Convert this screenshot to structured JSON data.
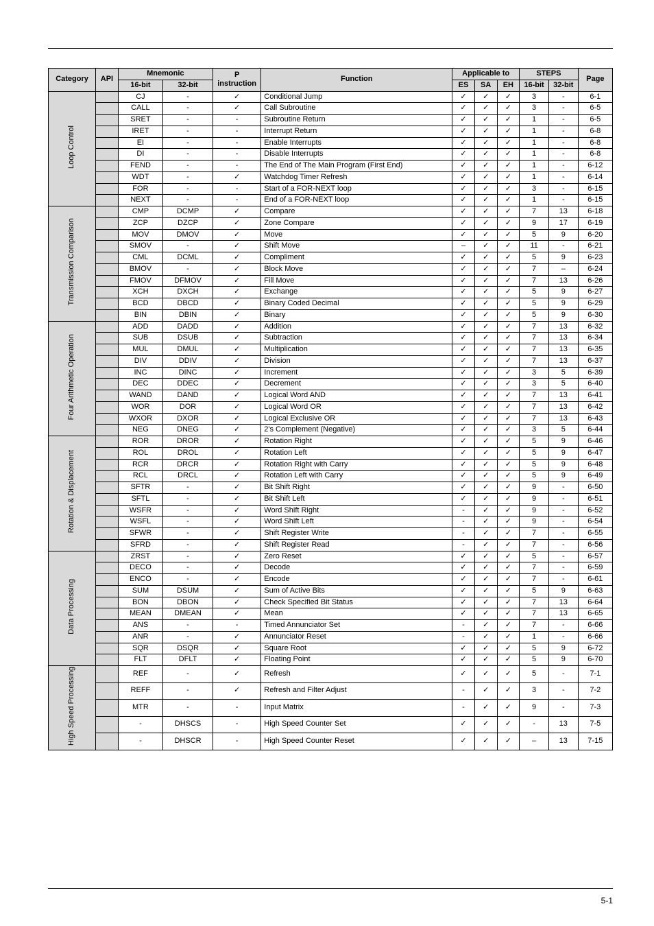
{
  "headers": {
    "category": "Category",
    "api": "API",
    "mnemonic": "Mnemonic",
    "p_instruction_top": "P",
    "p_instruction_bottom": "instruction",
    "function": "Function",
    "applicable": "Applicable to",
    "steps": "STEPS",
    "page": "Page",
    "m16": "16-bit",
    "m32": "32-bit",
    "es": "ES",
    "sa": "SA",
    "eh": "EH",
    "s16": "16-bit",
    "s32": "32-bit"
  },
  "footer": "5-1",
  "chart_data": {
    "type": "table",
    "title": "Instruction Reference Table",
    "columns": [
      "Category",
      "API",
      "Mnemonic 16-bit",
      "Mnemonic 32-bit",
      "P instruction",
      "Function",
      "ES",
      "SA",
      "EH",
      "STEPS 16-bit",
      "STEPS 32-bit",
      "Page"
    ],
    "groups": [
      {
        "category": "Loop Control",
        "rows": [
          {
            "api": "",
            "m16": "CJ",
            "m32": "-",
            "p": "✓",
            "fn": "Conditional Jump",
            "es": "✓",
            "sa": "✓",
            "eh": "✓",
            "s16": "3",
            "s32": "-",
            "page": "6-1"
          },
          {
            "api": "",
            "m16": "CALL",
            "m32": "-",
            "p": "✓",
            "fn": "Call Subroutine",
            "es": "✓",
            "sa": "✓",
            "eh": "✓",
            "s16": "3",
            "s32": "-",
            "page": "6-5"
          },
          {
            "api": "",
            "m16": "SRET",
            "m32": "-",
            "p": "-",
            "fn": "Subroutine Return",
            "es": "✓",
            "sa": "✓",
            "eh": "✓",
            "s16": "1",
            "s32": "-",
            "page": "6-5"
          },
          {
            "api": "",
            "m16": "IRET",
            "m32": "-",
            "p": "-",
            "fn": "Interrupt Return",
            "es": "✓",
            "sa": "✓",
            "eh": "✓",
            "s16": "1",
            "s32": "-",
            "page": "6-8"
          },
          {
            "api": "",
            "m16": "EI",
            "m32": "-",
            "p": "-",
            "fn": "Enable Interrupts",
            "es": "✓",
            "sa": "✓",
            "eh": "✓",
            "s16": "1",
            "s32": "-",
            "page": "6-8"
          },
          {
            "api": "",
            "m16": "DI",
            "m32": "-",
            "p": "-",
            "fn": "Disable Interrupts",
            "es": "✓",
            "sa": "✓",
            "eh": "✓",
            "s16": "1",
            "s32": "-",
            "page": "6-8"
          },
          {
            "api": "",
            "m16": "FEND",
            "m32": "-",
            "p": "-",
            "fn": "The End of The Main Program (First End)",
            "es": "✓",
            "sa": "✓",
            "eh": "✓",
            "s16": "1",
            "s32": "-",
            "page": "6-12"
          },
          {
            "api": "",
            "m16": "WDT",
            "m32": "-",
            "p": "✓",
            "fn": "Watchdog Timer Refresh",
            "es": "✓",
            "sa": "✓",
            "eh": "✓",
            "s16": "1",
            "s32": "-",
            "page": "6-14"
          },
          {
            "api": "",
            "m16": "FOR",
            "m32": "-",
            "p": "-",
            "fn": "Start of a FOR-NEXT loop",
            "es": "✓",
            "sa": "✓",
            "eh": "✓",
            "s16": "3",
            "s32": "-",
            "page": "6-15"
          },
          {
            "api": "",
            "m16": "NEXT",
            "m32": "-",
            "p": "-",
            "fn": "End of a FOR-NEXT loop",
            "es": "✓",
            "sa": "✓",
            "eh": "✓",
            "s16": "1",
            "s32": "-",
            "page": "6-15"
          }
        ]
      },
      {
        "category": "Transmission Comparison",
        "rows": [
          {
            "api": "",
            "m16": "CMP",
            "m32": "DCMP",
            "p": "✓",
            "fn": "Compare",
            "es": "✓",
            "sa": "✓",
            "eh": "✓",
            "s16": "7",
            "s32": "13",
            "page": "6-18"
          },
          {
            "api": "",
            "m16": "ZCP",
            "m32": "DZCP",
            "p": "✓",
            "fn": "Zone Compare",
            "es": "✓",
            "sa": "✓",
            "eh": "✓",
            "s16": "9",
            "s32": "17",
            "page": "6-19"
          },
          {
            "api": "",
            "m16": "MOV",
            "m32": "DMOV",
            "p": "✓",
            "fn": "Move",
            "es": "✓",
            "sa": "✓",
            "eh": "✓",
            "s16": "5",
            "s32": "9",
            "page": "6-20"
          },
          {
            "api": "",
            "m16": "SMOV",
            "m32": "-",
            "p": "✓",
            "fn": "Shift Move",
            "es": "–",
            "sa": "✓",
            "eh": "✓",
            "s16": "11",
            "s32": "-",
            "page": "6-21"
          },
          {
            "api": "",
            "m16": "CML",
            "m32": "DCML",
            "p": "✓",
            "fn": "Compliment",
            "es": "✓",
            "sa": "✓",
            "eh": "✓",
            "s16": "5",
            "s32": "9",
            "page": "6-23"
          },
          {
            "api": "",
            "m16": "BMOV",
            "m32": "-",
            "p": "✓",
            "fn": "Block Move",
            "es": "✓",
            "sa": "✓",
            "eh": "✓",
            "s16": "7",
            "s32": "–",
            "page": "6-24"
          },
          {
            "api": "",
            "m16": "FMOV",
            "m32": "DFMOV",
            "p": "✓",
            "fn": "Fill Move",
            "es": "✓",
            "sa": "✓",
            "eh": "✓",
            "s16": "7",
            "s32": "13",
            "page": "6-26"
          },
          {
            "api": "",
            "m16": "XCH",
            "m32": "DXCH",
            "p": "✓",
            "fn": "Exchange",
            "es": "✓",
            "sa": "✓",
            "eh": "✓",
            "s16": "5",
            "s32": "9",
            "page": "6-27"
          },
          {
            "api": "",
            "m16": "BCD",
            "m32": "DBCD",
            "p": "✓",
            "fn": "Binary Coded Decimal",
            "es": "✓",
            "sa": "✓",
            "eh": "✓",
            "s16": "5",
            "s32": "9",
            "page": "6-29"
          },
          {
            "api": "",
            "m16": "BIN",
            "m32": "DBIN",
            "p": "✓",
            "fn": "Binary",
            "es": "✓",
            "sa": "✓",
            "eh": "✓",
            "s16": "5",
            "s32": "9",
            "page": "6-30"
          }
        ]
      },
      {
        "category": "Four Arithmetic Operation",
        "rows": [
          {
            "api": "",
            "m16": "ADD",
            "m32": "DADD",
            "p": "✓",
            "fn": "Addition",
            "es": "✓",
            "sa": "✓",
            "eh": "✓",
            "s16": "7",
            "s32": "13",
            "page": "6-32"
          },
          {
            "api": "",
            "m16": "SUB",
            "m32": "DSUB",
            "p": "✓",
            "fn": "Subtraction",
            "es": "✓",
            "sa": "✓",
            "eh": "✓",
            "s16": "7",
            "s32": "13",
            "page": "6-34"
          },
          {
            "api": "",
            "m16": "MUL",
            "m32": "DMUL",
            "p": "✓",
            "fn": "Multiplication",
            "es": "✓",
            "sa": "✓",
            "eh": "✓",
            "s16": "7",
            "s32": "13",
            "page": "6-35"
          },
          {
            "api": "",
            "m16": "DIV",
            "m32": "DDIV",
            "p": "✓",
            "fn": "Division",
            "es": "✓",
            "sa": "✓",
            "eh": "✓",
            "s16": "7",
            "s32": "13",
            "page": "6-37"
          },
          {
            "api": "",
            "m16": "INC",
            "m32": "DINC",
            "p": "✓",
            "fn": "Increment",
            "es": "✓",
            "sa": "✓",
            "eh": "✓",
            "s16": "3",
            "s32": "5",
            "page": "6-39"
          },
          {
            "api": "",
            "m16": "DEC",
            "m32": "DDEC",
            "p": "✓",
            "fn": "Decrement",
            "es": "✓",
            "sa": "✓",
            "eh": "✓",
            "s16": "3",
            "s32": "5",
            "page": "6-40"
          },
          {
            "api": "",
            "m16": "WAND",
            "m32": "DAND",
            "p": "✓",
            "fn": "Logical Word AND",
            "es": "✓",
            "sa": "✓",
            "eh": "✓",
            "s16": "7",
            "s32": "13",
            "page": "6-41"
          },
          {
            "api": "",
            "m16": "WOR",
            "m32": "DOR",
            "p": "✓",
            "fn": "Logical Word OR",
            "es": "✓",
            "sa": "✓",
            "eh": "✓",
            "s16": "7",
            "s32": "13",
            "page": "6-42"
          },
          {
            "api": "",
            "m16": "WXOR",
            "m32": "DXOR",
            "p": "✓",
            "fn": "Logical Exclusive OR",
            "es": "✓",
            "sa": "✓",
            "eh": "✓",
            "s16": "7",
            "s32": "13",
            "page": "6-43"
          },
          {
            "api": "",
            "m16": "NEG",
            "m32": "DNEG",
            "p": "✓",
            "fn": "2's Complement (Negative)",
            "es": "✓",
            "sa": "✓",
            "eh": "✓",
            "s16": "3",
            "s32": "5",
            "page": "6-44"
          }
        ]
      },
      {
        "category": "Rotation & Displacement",
        "rows": [
          {
            "api": "",
            "m16": "ROR",
            "m32": "DROR",
            "p": "✓",
            "fn": "Rotation Right",
            "es": "✓",
            "sa": "✓",
            "eh": "✓",
            "s16": "5",
            "s32": "9",
            "page": "6-46"
          },
          {
            "api": "",
            "m16": "ROL",
            "m32": "DROL",
            "p": "✓",
            "fn": "Rotation Left",
            "es": "✓",
            "sa": "✓",
            "eh": "✓",
            "s16": "5",
            "s32": "9",
            "page": "6-47"
          },
          {
            "api": "",
            "m16": "RCR",
            "m32": "DRCR",
            "p": "✓",
            "fn": "Rotation Right with Carry",
            "es": "✓",
            "sa": "✓",
            "eh": "✓",
            "s16": "5",
            "s32": "9",
            "page": "6-48"
          },
          {
            "api": "",
            "m16": "RCL",
            "m32": "DRCL",
            "p": "✓",
            "fn": "Rotation Left with Carry",
            "es": "✓",
            "sa": "✓",
            "eh": "✓",
            "s16": "5",
            "s32": "9",
            "page": "6-49"
          },
          {
            "api": "",
            "m16": "SFTR",
            "m32": "-",
            "p": "✓",
            "fn": "Bit Shift Right",
            "es": "✓",
            "sa": "✓",
            "eh": "✓",
            "s16": "9",
            "s32": "-",
            "page": "6-50"
          },
          {
            "api": "",
            "m16": "SFTL",
            "m32": "-",
            "p": "✓",
            "fn": "Bit Shift Left",
            "es": "✓",
            "sa": "✓",
            "eh": "✓",
            "s16": "9",
            "s32": "-",
            "page": "6-51"
          },
          {
            "api": "",
            "m16": "WSFR",
            "m32": "-",
            "p": "✓",
            "fn": "Word Shift Right",
            "es": "-",
            "sa": "✓",
            "eh": "✓",
            "s16": "9",
            "s32": "-",
            "page": "6-52"
          },
          {
            "api": "",
            "m16": "WSFL",
            "m32": "-",
            "p": "✓",
            "fn": "Word Shift Left",
            "es": "-",
            "sa": "✓",
            "eh": "✓",
            "s16": "9",
            "s32": "-",
            "page": "6-54"
          },
          {
            "api": "",
            "m16": "SFWR",
            "m32": "-",
            "p": "✓",
            "fn": "Shift Register Write",
            "es": "-",
            "sa": "✓",
            "eh": "✓",
            "s16": "7",
            "s32": "-",
            "page": "6-55"
          },
          {
            "api": "",
            "m16": "SFRD",
            "m32": "-",
            "p": "✓",
            "fn": "Shift Register Read",
            "es": "-",
            "sa": "✓",
            "eh": "✓",
            "s16": "7",
            "s32": "-",
            "page": "6-56"
          }
        ]
      },
      {
        "category": "Data Processing",
        "rows": [
          {
            "api": "",
            "m16": "ZRST",
            "m32": "-",
            "p": "✓",
            "fn": "Zero Reset",
            "es": "✓",
            "sa": "✓",
            "eh": "✓",
            "s16": "5",
            "s32": "-",
            "page": "6-57"
          },
          {
            "api": "",
            "m16": "DECO",
            "m32": "-",
            "p": "✓",
            "fn": "Decode",
            "es": "✓",
            "sa": "✓",
            "eh": "✓",
            "s16": "7",
            "s32": "-",
            "page": "6-59"
          },
          {
            "api": "",
            "m16": "ENCO",
            "m32": "-",
            "p": "✓",
            "fn": "Encode",
            "es": "✓",
            "sa": "✓",
            "eh": "✓",
            "s16": "7",
            "s32": "-",
            "page": "6-61"
          },
          {
            "api": "",
            "m16": "SUM",
            "m32": "DSUM",
            "p": "✓",
            "fn": "Sum of Active Bits",
            "es": "✓",
            "sa": "✓",
            "eh": "✓",
            "s16": "5",
            "s32": "9",
            "page": "6-63"
          },
          {
            "api": "",
            "m16": "BON",
            "m32": "DBON",
            "p": "✓",
            "fn": "Check Specified Bit Status",
            "es": "✓",
            "sa": "✓",
            "eh": "✓",
            "s16": "7",
            "s32": "13",
            "page": "6-64"
          },
          {
            "api": "",
            "m16": "MEAN",
            "m32": "DMEAN",
            "p": "✓",
            "fn": "Mean",
            "es": "✓",
            "sa": "✓",
            "eh": "✓",
            "s16": "7",
            "s32": "13",
            "page": "6-65"
          },
          {
            "api": "",
            "m16": "ANS",
            "m32": "-",
            "p": "-",
            "fn": "Timed Annunciator Set",
            "es": "-",
            "sa": "✓",
            "eh": "✓",
            "s16": "7",
            "s32": "-",
            "page": "6-66"
          },
          {
            "api": "",
            "m16": "ANR",
            "m32": "-",
            "p": "✓",
            "fn": "Annunciator Reset",
            "es": "-",
            "sa": "✓",
            "eh": "✓",
            "s16": "1",
            "s32": "-",
            "page": "6-66"
          },
          {
            "api": "",
            "m16": "SQR",
            "m32": "DSQR",
            "p": "✓",
            "fn": "Square Root",
            "es": "✓",
            "sa": "✓",
            "eh": "✓",
            "s16": "5",
            "s32": "9",
            "page": "6-72"
          },
          {
            "api": "",
            "m16": "FLT",
            "m32": "DFLT",
            "p": "✓",
            "fn": "Floating Point",
            "es": "✓",
            "sa": "✓",
            "eh": "✓",
            "s16": "5",
            "s32": "9",
            "page": "6-70"
          }
        ]
      },
      {
        "category": "High Speed Processing",
        "rows": [
          {
            "api": "",
            "m16": "REF",
            "m32": "-",
            "p": "✓",
            "fn": "Refresh",
            "es": "✓",
            "sa": "✓",
            "eh": "✓",
            "s16": "5",
            "s32": "-",
            "page": "7-1"
          },
          {
            "api": "",
            "m16": "REFF",
            "m32": "-",
            "p": "✓",
            "fn": "Refresh and Filter Adjust",
            "es": "-",
            "sa": "✓",
            "eh": "✓",
            "s16": "3",
            "s32": "-",
            "page": "7-2"
          },
          {
            "api": "",
            "m16": "MTR",
            "m32": "-",
            "p": "-",
            "fn": "Input Matrix",
            "es": "-",
            "sa": "✓",
            "eh": "✓",
            "s16": "9",
            "s32": "-",
            "page": "7-3"
          },
          {
            "api": "",
            "m16": "-",
            "m32": "DHSCS",
            "p": "-",
            "fn": "High Speed Counter Set",
            "es": "✓",
            "sa": "✓",
            "eh": "✓",
            "s16": "-",
            "s32": "13",
            "page": "7-5"
          },
          {
            "api": "",
            "m16": "-",
            "m32": "DHSCR",
            "p": "-",
            "fn": "High Speed Counter Reset",
            "es": "✓",
            "sa": "✓",
            "eh": "✓",
            "s16": "–",
            "s32": "13",
            "page": "7-15"
          }
        ]
      }
    ]
  }
}
